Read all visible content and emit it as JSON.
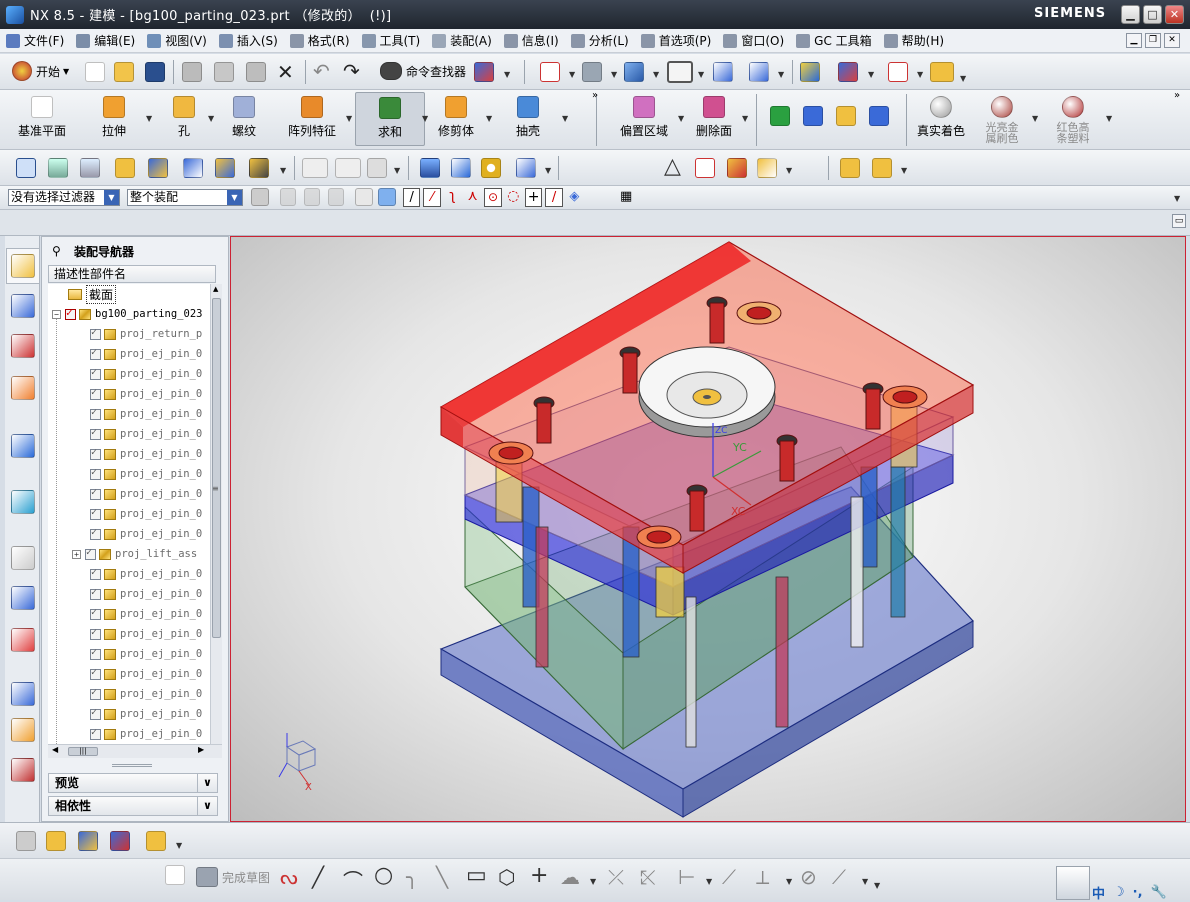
{
  "window": {
    "title": "NX 8.5 - 建模 - [bg100_parting_023.prt （修改的）  (!)]",
    "brand": "SIEMENS"
  },
  "menubar": [
    {
      "label": "文件(F)",
      "icon": "file-menu-icon",
      "color": "#5b7bbf"
    },
    {
      "label": "编辑(E)",
      "icon": "edit-menu-icon",
      "color": "#7b8da8"
    },
    {
      "label": "视图(V)",
      "icon": "view-menu-icon",
      "color": "#6f8fb8"
    },
    {
      "label": "插入(S)",
      "icon": "insert-menu-icon",
      "color": "#7c90b0"
    },
    {
      "label": "格式(R)",
      "icon": "format-menu-icon",
      "color": "#8a95a8"
    },
    {
      "label": "工具(T)",
      "icon": "tools-menu-icon",
      "color": "#8797ad"
    },
    {
      "label": "装配(A)",
      "icon": "assembly-menu-icon",
      "color": "#9aa6b7"
    },
    {
      "label": "信息(I)",
      "icon": "info-menu-icon",
      "color": "#8a95a8"
    },
    {
      "label": "分析(L)",
      "icon": "analysis-menu-icon",
      "color": "#8a95a8"
    },
    {
      "label": "首选项(P)",
      "icon": "preferences-menu-icon",
      "color": "#8a95a8"
    },
    {
      "label": "窗口(O)",
      "icon": "window-menu-icon",
      "color": "#8a95a8"
    },
    {
      "label": "GC 工具箱",
      "icon": "gc-toolbox-icon",
      "color": "#8a95a8"
    },
    {
      "label": "帮助(H)",
      "icon": "help-menu-icon",
      "color": "#8a95a8"
    }
  ],
  "toolbar1": {
    "start_label": "开始",
    "cmd_finder_label": "命令查找器"
  },
  "toolbar2": [
    {
      "label": "基准平面",
      "color": "#ffffff"
    },
    {
      "label": "拉伸",
      "color": "#f0a030"
    },
    {
      "label": "孔",
      "color": "#f0b840"
    },
    {
      "label": "螺纹",
      "color": "#a0b0d8"
    },
    {
      "label": "阵列特征",
      "color": "#e88a2a"
    },
    {
      "label": "求和",
      "color": "#3a8a3a"
    },
    {
      "label": "修剪体",
      "color": "#f0a030"
    },
    {
      "label": "抽壳",
      "color": "#4a8ad8"
    },
    {
      "label": "偏置区域",
      "color": "#d070c0"
    },
    {
      "label": "删除面",
      "color": "#d05090"
    },
    {
      "label": "真实着色",
      "color": "#9a9a9a"
    },
    {
      "label": "光亮金属刷色",
      "color": "#a8403a"
    },
    {
      "label": "红色高条塑料",
      "color": "#b03030"
    }
  ],
  "selection": {
    "filter": "没有选择过滤器",
    "scope": "整个装配"
  },
  "navigator": {
    "title": "装配导航器",
    "column_header": "描述性部件名",
    "section_node": "截面",
    "root": "bg100_parting_023",
    "children": [
      "proj_return_p",
      "proj_ej_pin_0",
      "proj_ej_pin_0",
      "proj_ej_pin_0",
      "proj_ej_pin_0",
      "proj_ej_pin_0",
      "proj_ej_pin_0",
      "proj_ej_pin_0",
      "proj_ej_pin_0",
      "proj_ej_pin_0",
      "proj_ej_pin_0",
      "proj_lift_ass",
      "proj_ej_pin_0",
      "proj_ej_pin_0",
      "proj_ej_pin_0",
      "proj_ej_pin_0",
      "proj_ej_pin_0",
      "proj_ej_pin_0",
      "proj_ej_pin_0",
      "proj_ej_pin_0",
      "proj_ej_pin_0"
    ],
    "panels": [
      "预览",
      "相依性"
    ]
  },
  "viewport": {
    "axis_labels": {
      "yc": "YC",
      "xc": "XC",
      "zc": "ZC"
    },
    "triad_x": "X"
  },
  "sketch_bar": {
    "finish_sketch": "完成草图"
  },
  "ime": {
    "zh": "中",
    "moon": "☽",
    "dots": "·,",
    "wrench": "🔧"
  }
}
